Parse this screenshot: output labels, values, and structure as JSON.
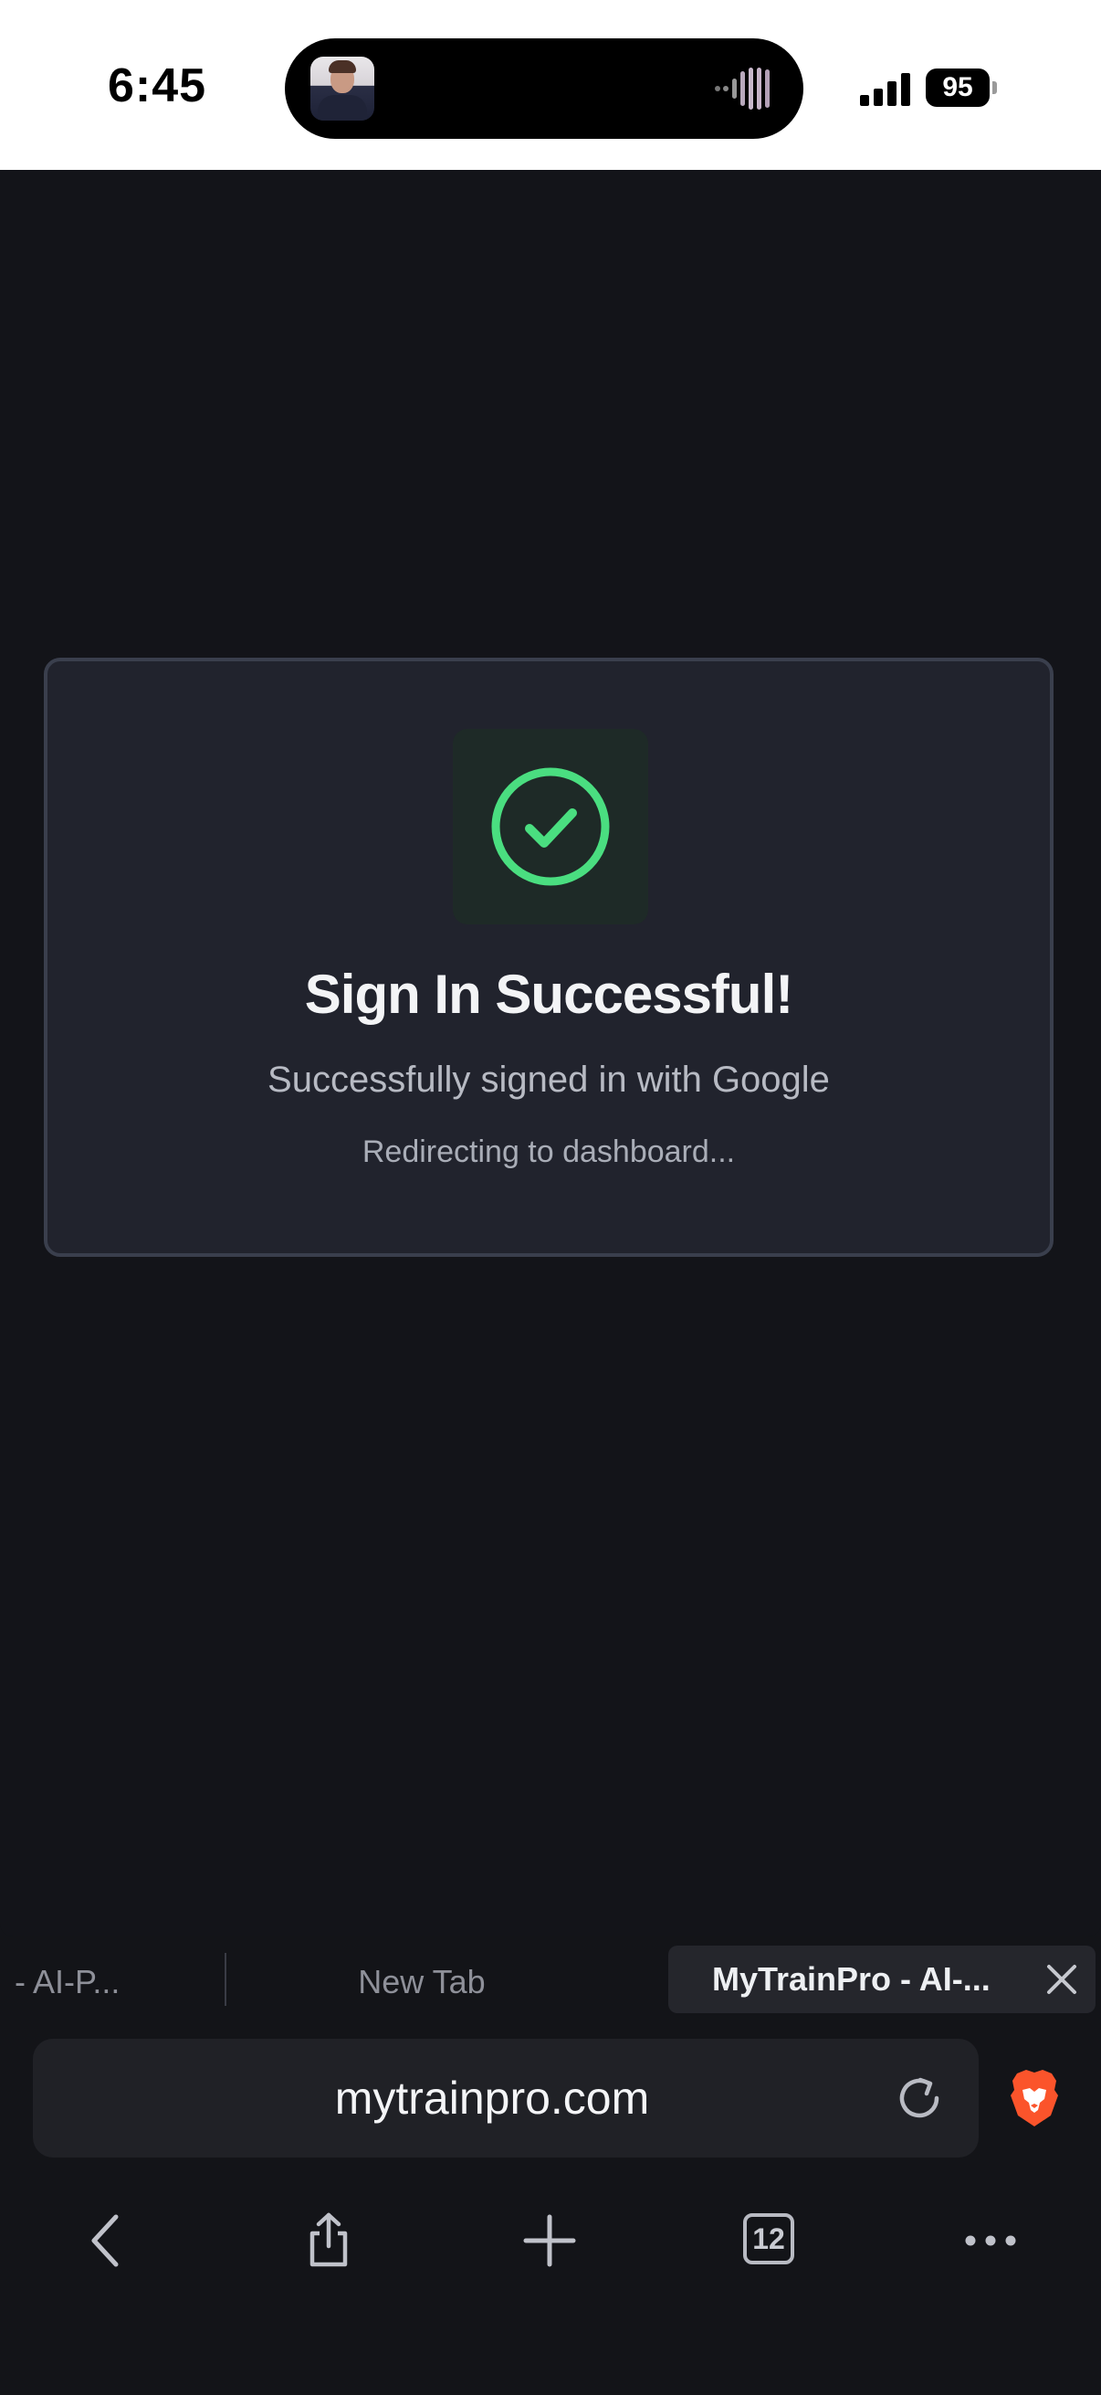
{
  "status_bar": {
    "time": "6:45",
    "battery": "95"
  },
  "card": {
    "title": "Sign In Successful!",
    "subtitle": "Successfully signed in with Google",
    "note": "Redirecting to dashboard...",
    "accent_color": "#4ade80"
  },
  "browser": {
    "tabs": [
      {
        "label": "- AI-P..."
      },
      {
        "label": "New Tab"
      },
      {
        "label": "MyTrainPro - AI-..."
      }
    ],
    "url": "mytrainpro.com",
    "tab_count": "12",
    "icons": {
      "back": "chevron-left-icon",
      "share": "share-icon",
      "new_tab": "plus-icon",
      "tabs": "tabs-count-icon",
      "menu": "more-icon",
      "reload": "reload-icon",
      "browser": "brave-lion-icon"
    }
  }
}
